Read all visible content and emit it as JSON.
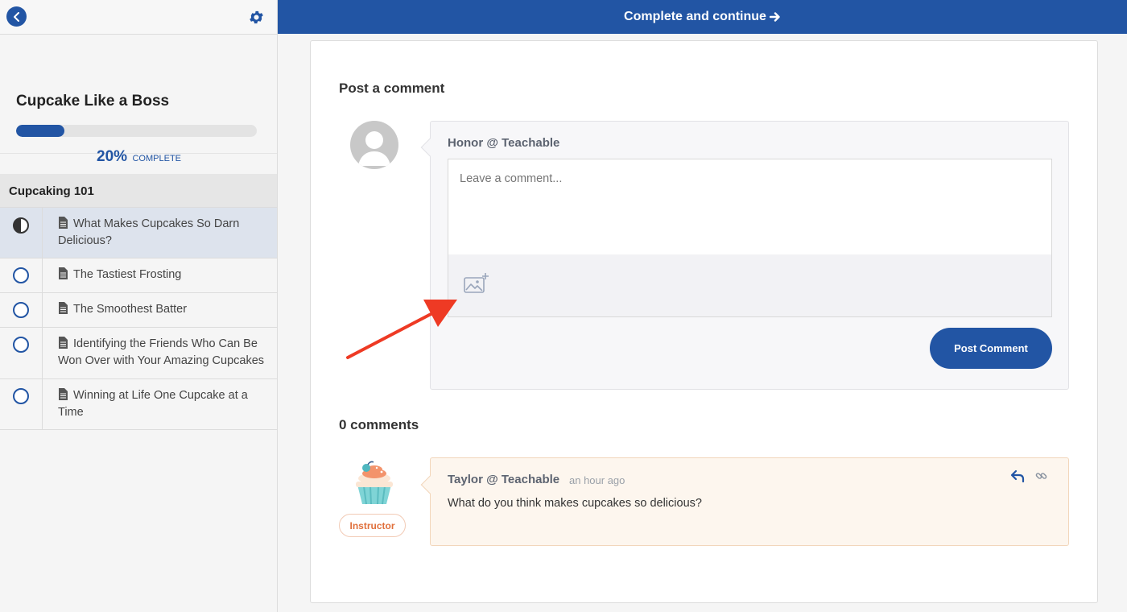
{
  "sidebar": {
    "course_title": "Cupcake Like a Boss",
    "progress_fraction": 0.2,
    "progress_percent": "20%",
    "progress_label": "COMPLETE",
    "section_title": "Cupcaking 101",
    "lectures": [
      {
        "title": "What Makes Cupcakes So Darn Delicious?",
        "status": "in-progress"
      },
      {
        "title": "The Tastiest Frosting",
        "status": "incomplete"
      },
      {
        "title": "The Smoothest Batter",
        "status": "incomplete"
      },
      {
        "title": "Identifying the Friends Who Can Be Won Over with Your Amazing Cupcakes",
        "status": "incomplete"
      },
      {
        "title": "Winning at Life One Cupcake at a Time",
        "status": "incomplete"
      }
    ]
  },
  "topbar": {
    "label": "Complete and continue"
  },
  "comments": {
    "post_heading": "Post a comment",
    "current_user": "Honor @ Teachable",
    "placeholder": "Leave a comment...",
    "submit_label": "Post Comment",
    "count_heading": "0 comments",
    "items": [
      {
        "author": "Taylor @ Teachable",
        "time": "an hour ago",
        "text": "What do you think makes cupcakes so delicious?",
        "badge": "Instructor"
      }
    ]
  },
  "icons": {
    "back": "chevron-left-icon",
    "settings": "gear-icon",
    "lecture": "document-icon",
    "attach_image": "image-add-icon",
    "reply": "reply-icon",
    "permalink": "link-icon"
  },
  "colors": {
    "brand": "#2255a4",
    "instructor_accent": "#e0703c",
    "annotation_arrow": "#ee3a24"
  }
}
